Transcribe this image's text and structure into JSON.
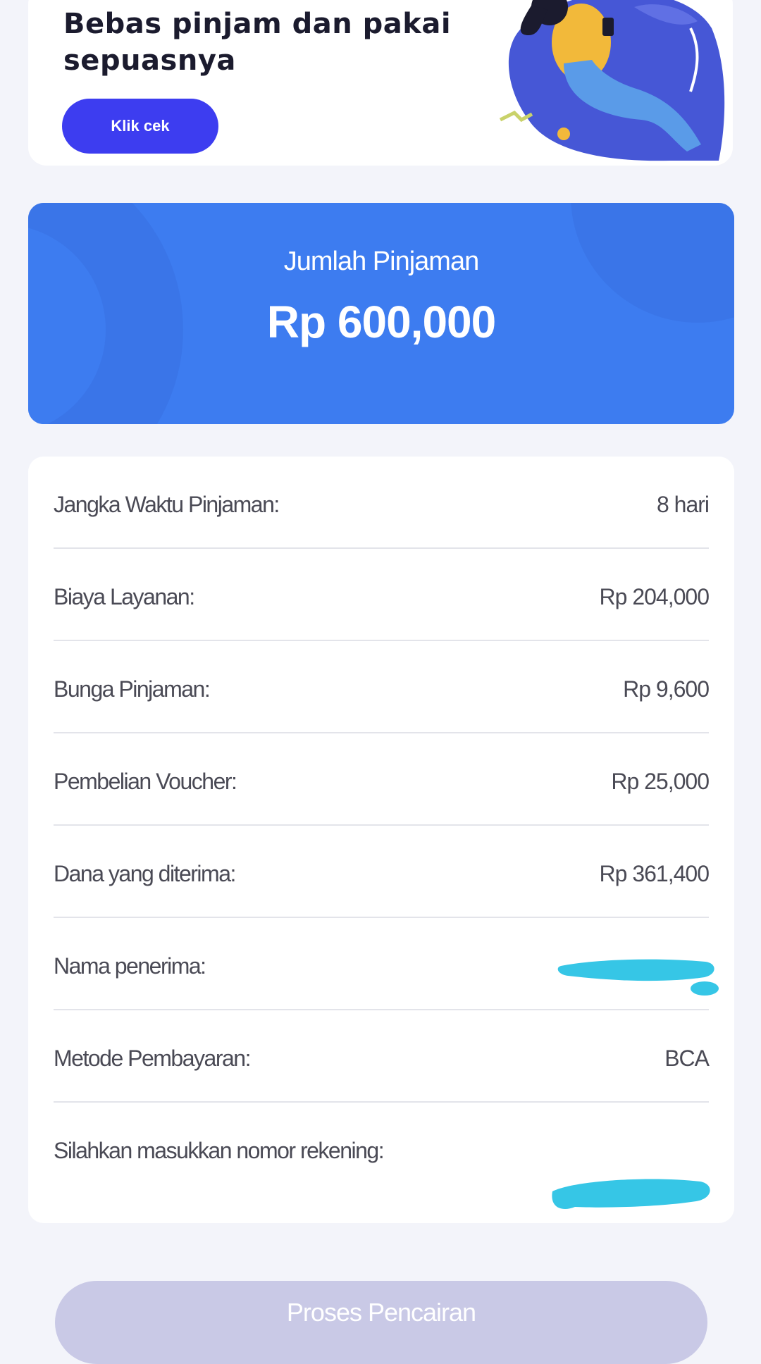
{
  "banner": {
    "title": "Bebas pinjam dan pakai sepuasnya",
    "button_label": "Klik cek"
  },
  "loan": {
    "label": "Jumlah Pinjaman",
    "amount": "Rp 600,000"
  },
  "details": [
    {
      "label": "Jangka Waktu Pinjaman:",
      "value": "8 hari"
    },
    {
      "label": "Biaya Layanan:",
      "value": "Rp 204,000"
    },
    {
      "label": "Bunga Pinjaman:",
      "value": "Rp 9,600"
    },
    {
      "label": "Pembelian Voucher:",
      "value": "Rp 25,000"
    },
    {
      "label": "Dana yang diterima:",
      "value": "Rp 361,400"
    },
    {
      "label": "Nama penerima:",
      "value": ""
    },
    {
      "label": "Metode Pembayaran:",
      "value": "BCA"
    },
    {
      "label": "Silahkan masukkan nomor rekening:",
      "value": ""
    }
  ],
  "submit": {
    "label": "Proses Pencairan"
  },
  "colors": {
    "banner_button": "#3d3df0",
    "amount_card": "#3d7cf0",
    "submit_disabled": "#c9c9e6",
    "redaction": "#36c6e6"
  }
}
